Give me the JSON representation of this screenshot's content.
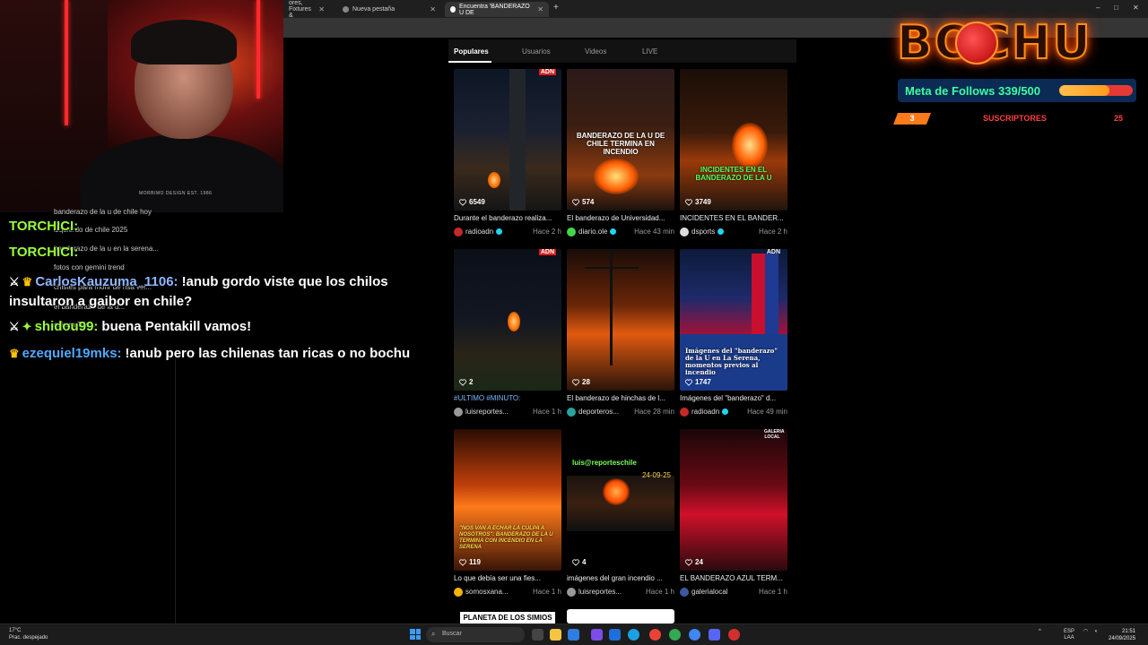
{
  "browser": {
    "tabs": [
      {
        "title": "ores, Fixtures &"
      },
      {
        "title": "Nueva pestaña"
      },
      {
        "title": "Encuentra 'BANDERAZO U DE"
      }
    ],
    "new_tab_symbol": "+",
    "window_controls": [
      "–",
      "□",
      "✕"
    ]
  },
  "search_tabs": [
    "Populares",
    "Usuarios",
    "Videos",
    "LIVE"
  ],
  "videos": [
    {
      "likes": "6549",
      "desc": "Durante el banderazo realiza...",
      "author": "radioadn",
      "verified": true,
      "time": "Hace 2 h",
      "overlay": "",
      "badge": "ADN"
    },
    {
      "likes": "574",
      "desc": "El banderazo de Universidad...",
      "author": "diario.ole",
      "verified": true,
      "time": "Hace 43 min",
      "overlay": "BANDERAZO DE LA U DE CHILE TERMINA EN INCENDIO",
      "badge": ""
    },
    {
      "likes": "3749",
      "desc": "INCIDENTES EN EL BANDER...",
      "author": "dsports",
      "verified": true,
      "time": "Hace 2 h",
      "overlay": "INCIDENTES EN EL BANDERAZO DE LA U",
      "badge": ""
    },
    {
      "likes": "2",
      "desc": "#ULTIMO #MINUTO:",
      "author": "luisreportes...",
      "verified": false,
      "time": "Hace 1 h",
      "overlay": "",
      "badge": "ADN"
    },
    {
      "likes": "28",
      "desc": "El banderazo de hinchas de l...",
      "author": "deporteros...",
      "verified": false,
      "time": "Hace 28 min",
      "overlay": "",
      "badge": ""
    },
    {
      "likes": "1747",
      "desc": "Imágenes del \"banderazo\" d...",
      "author": "radioadn",
      "verified": true,
      "time": "Hace 49 min",
      "overlay": "Imágenes del \"banderazo\" de la U en La Serena, momentos previos al incendio",
      "badge": "ADN"
    },
    {
      "likes": "119",
      "desc": "Lo que debía ser una fies...",
      "author": "somosxana...",
      "verified": false,
      "time": "Hace 1 h",
      "overlay": "\"NOS VAN A ECHAR LA CULPA A NOSOTROS\": BANDERAZO DE LA U TERMINA CON INCENDIO EN LA SERENA",
      "badge": ""
    },
    {
      "likes": "4",
      "desc": "imágenes del gran incendio ...",
      "author": "luisreportes...",
      "verified": false,
      "time": "Hace 1 h",
      "overlay": "luis@reporteschile",
      "date_tag": "24-09-25",
      "badge": ""
    },
    {
      "likes": "24",
      "desc": "EL BANDERAZO AZUL TERM...",
      "author": "galerialocal",
      "verified": false,
      "time": "Hace 1 h",
      "overlay": "",
      "badge": "GALERÍA LOCAL"
    }
  ],
  "bottom_peek": {
    "title": "PLANETA DE LOS SIMIOS"
  },
  "cam": {
    "shirt": "MORBIMO DESIGN EST. 1986"
  },
  "chat": {
    "ghost_lines": [
      "banderazo de la u de chile hoy",
      "izquierdo de chile 2025",
      "banderazo de la u en la serena...",
      "fotos con gemini trend",
      "chistes para morir de risa vel...",
      "el banderazo de la u...",
      "sakura Trio..."
    ],
    "messages": [
      {
        "user": "TORCHICI:",
        "text": "",
        "user_color": "#9aff3c"
      },
      {
        "user": "TORCHICI:",
        "text": "",
        "user_color": "#9aff3c"
      },
      {
        "user": "CarlosKauzuma_1106:",
        "text": "!anub gordo viste que los chilos insultaron a gaibor en chile?",
        "user_color": "#8fb6ff"
      },
      {
        "user": "shidou99:",
        "text": "buena Pentakill vamos!",
        "user_color": "#9aff3c"
      },
      {
        "user": "ezequiel19mks:",
        "text": "!anub pero las chilenas tan ricas o no bochu",
        "user_color": "#4fa9ff"
      }
    ]
  },
  "overlay": {
    "logo": "BOCHU",
    "follow_goal_label": "Meta de Follows 339/500",
    "follow_goal_fraction": 0.678,
    "subs_left": "3",
    "subs_label": "SUSCRIPTORES",
    "subs_count": "25"
  },
  "taskbar": {
    "weather_temp": "17°C",
    "weather_desc": "Prac. despejado",
    "search_placeholder": "Buscar",
    "lang_1": "ESP",
    "lang_2": "LAA",
    "time": "21:51",
    "date": "24/09/2025"
  },
  "colors": {
    "accent_verified": "#20d5ec",
    "brand_orange": "#ff8c1a",
    "goal_bar": "#0b2b55"
  }
}
